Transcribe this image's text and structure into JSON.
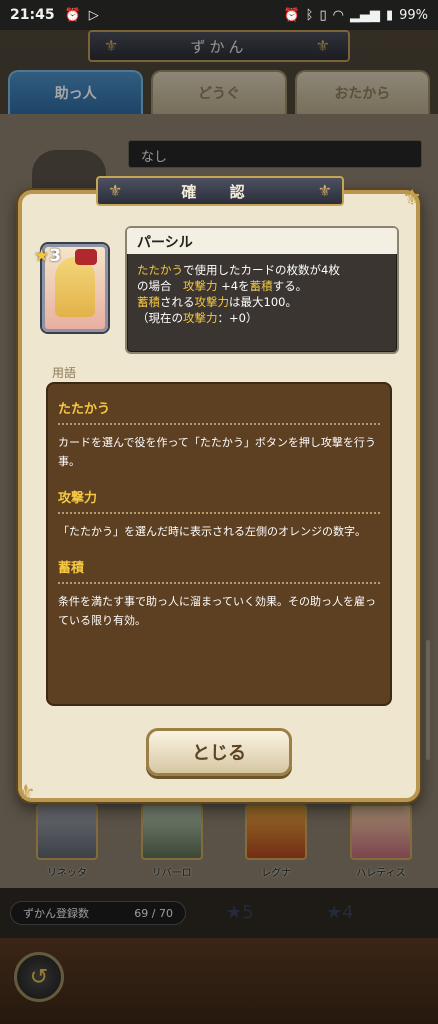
{
  "status_bar": {
    "time": "21:45",
    "battery": "99%"
  },
  "header": {
    "title": "ずかん"
  },
  "tabs": [
    {
      "label": "助っ人",
      "active": true
    },
    {
      "label": "どうぐ",
      "active": false
    },
    {
      "label": "おたから",
      "active": false
    }
  ],
  "background": {
    "selected_label": "なし",
    "characters": [
      {
        "name": "リネッタ"
      },
      {
        "name": "リバーロ"
      },
      {
        "name": "レグナ"
      },
      {
        "name": "ハレティス"
      }
    ],
    "registration": {
      "label": "ずかん登録数",
      "value": "69 / 70"
    },
    "faded_ranks": [
      "5",
      "4"
    ]
  },
  "dialog": {
    "title": "確 認",
    "card": {
      "rank": "3",
      "name": "パーシル"
    },
    "description": {
      "line1_pre": "たたかう",
      "line1_post": "で使用したカードの枚数が4枚",
      "line2_pre": "の場合　",
      "line2_kw1": "攻撃力",
      "line2_mid": " +4を",
      "line2_kw2": "蓄積",
      "line2_post": "する。",
      "line3_kw1": "蓄積",
      "line3_mid": "される",
      "line3_kw2": "攻撃力",
      "line3_post": "は最大100。",
      "line4_pre": "（現在の",
      "line4_kw": "攻撃力",
      "line4_post": "：+0）"
    },
    "glossary_label": "用語",
    "glossary": [
      {
        "term": "たたかう",
        "desc": "カードを選んで役を作って「たたかう」ボタンを押し攻撃を行う事。"
      },
      {
        "term": "攻撃力",
        "desc": "「たたかう」を選んだ時に表示される左側のオレンジの数字。"
      },
      {
        "term": "蓄積",
        "desc": "条件を満たす事で助っ人に溜まっていく効果。その助っ人を雇っている限り有効。"
      }
    ],
    "close_label": "とじる"
  }
}
